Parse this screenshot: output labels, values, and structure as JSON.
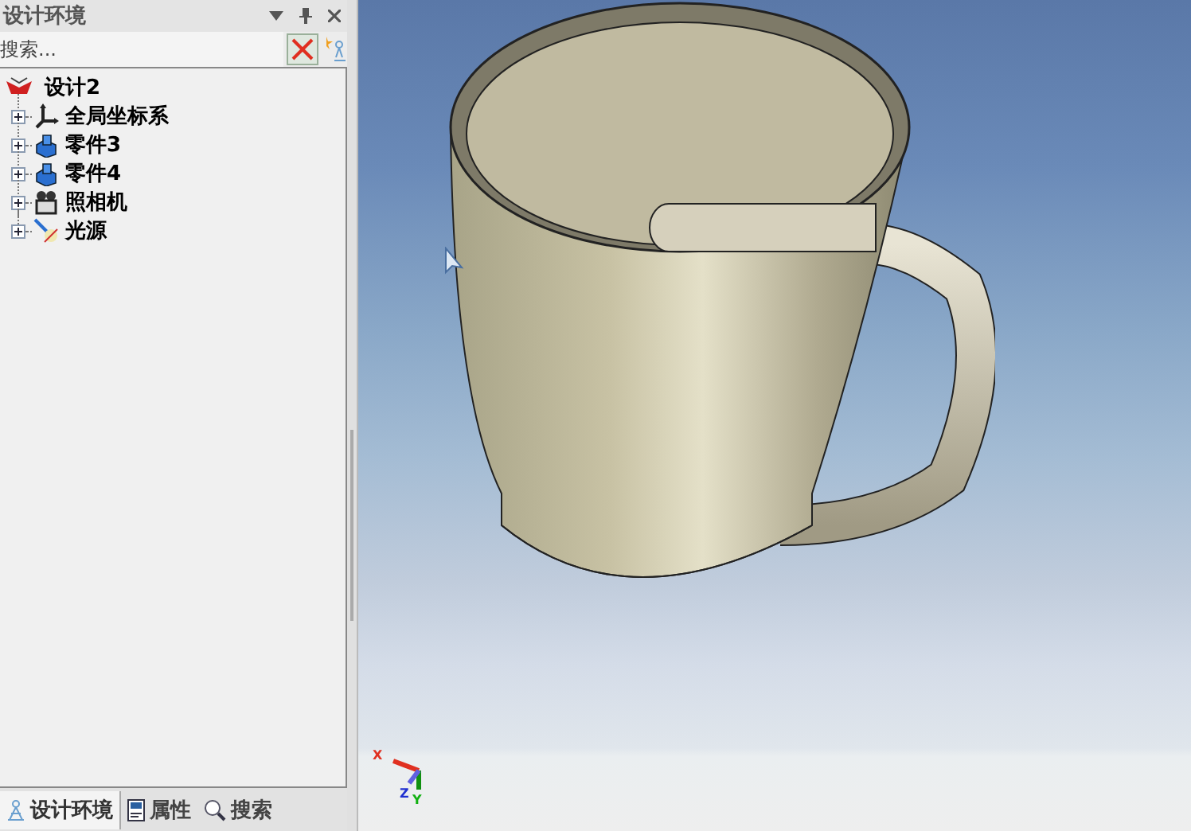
{
  "panel": {
    "title": "设计环境",
    "search": {
      "placeholder": "搜索..."
    }
  },
  "tree": {
    "label": "设计2",
    "children": [
      {
        "label": "全局坐标系",
        "kind": "axes",
        "expanded": false
      },
      {
        "label": "零件3",
        "kind": "part",
        "expanded": false
      },
      {
        "label": "零件4",
        "kind": "part",
        "expanded": false
      },
      {
        "label": "照相机",
        "kind": "camera",
        "expanded": false
      },
      {
        "label": "光源",
        "kind": "light",
        "expanded": false
      }
    ]
  },
  "bottom_tabs": [
    {
      "label": "设计环境",
      "kind": "design",
      "selected": true
    },
    {
      "label": "属性",
      "kind": "props",
      "selected": false
    },
    {
      "label": "搜索",
      "kind": "search",
      "selected": false
    }
  ],
  "axis_triad": {
    "x": "X",
    "y": "Y",
    "z": "Z"
  }
}
